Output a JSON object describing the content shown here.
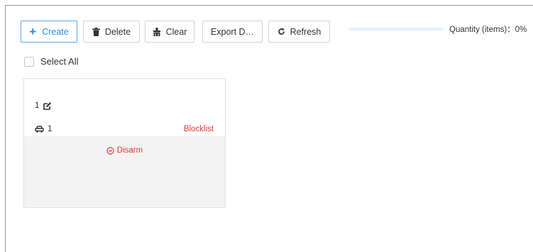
{
  "toolbar": {
    "create_label": "Create",
    "delete_label": "Delete",
    "clear_label": "Clear",
    "export_label": "Export D…",
    "refresh_label": "Refresh",
    "accent_color": "#2b8ce0"
  },
  "progress": {
    "label": "Quantity (items)：0%",
    "value_percent": 0
  },
  "select_all": {
    "label": "Select All",
    "checked": false
  },
  "cards": [
    {
      "name": "1",
      "vehicle": "1",
      "status": "Blocklist",
      "status_color": "#e53935",
      "action": "Disarm",
      "icons": [
        "edit-icon",
        "car-icon",
        "minus-circle-icon"
      ]
    }
  ]
}
